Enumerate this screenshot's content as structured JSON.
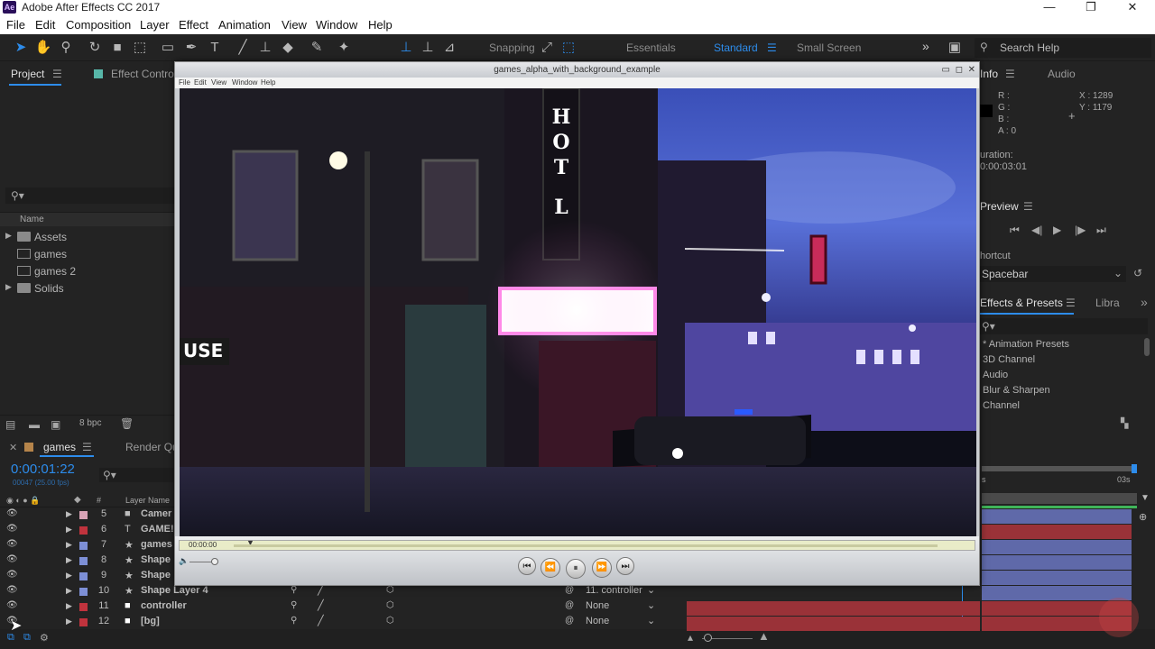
{
  "app": {
    "title": "Adobe After Effects CC 2017",
    "logo": "Ae",
    "minimize": "—",
    "restore": "❐",
    "close": "✕"
  },
  "menu": [
    "File",
    "Edit",
    "Composition",
    "Layer",
    "Effect",
    "Animation",
    "View",
    "Window",
    "Help"
  ],
  "toolbar": {
    "snapping": "Snapping",
    "workspaces": [
      "Essentials",
      "Standard",
      "Small Screen"
    ],
    "active_workspace": "Standard",
    "search_placeholder": "Search Help",
    "overflow": "»"
  },
  "project_panel": {
    "tab": "Project",
    "effect_tab": "Effect Contro",
    "column_name": "Name",
    "items": [
      {
        "label": "Assets",
        "type": "folder",
        "expander": "▶"
      },
      {
        "label": "games",
        "type": "comp",
        "expander": ""
      },
      {
        "label": "games 2",
        "type": "comp",
        "expander": ""
      },
      {
        "label": "Solids",
        "type": "folder",
        "expander": "▶"
      }
    ],
    "bpc": "8 bpc"
  },
  "info_panel": {
    "tab": "Info",
    "audio_tab": "Audio",
    "r": "R :",
    "g": "G :",
    "b": "B :",
    "a": "A : 0",
    "x": "X : 1289",
    "y": "Y : 1179",
    "duration_label": "uration:",
    "duration_value": "0:00:03:01"
  },
  "preview_panel": {
    "tab": "Preview",
    "shortcut_label": "hortcut",
    "shortcut_value": "Spacebar"
  },
  "effects_panel": {
    "tab": "Effects & Presets",
    "libraries_tab": "Libra",
    "items": [
      "* Animation Presets",
      "3D Channel",
      "Audio",
      "Blur & Sharpen",
      "Channel"
    ]
  },
  "timeline": {
    "tab": "games",
    "render_tab": "Render Qu",
    "timecode": "0:00:01:22",
    "frame_info": "00047 (25.00 fps)",
    "col_num": "#",
    "col_layer": "Layer Name",
    "ruler_end": "03s",
    "ruler_start": "s",
    "layers": [
      {
        "num": "5",
        "name": "Camer",
        "type_icon": "camera",
        "color": "#d8a3b6",
        "parent": ""
      },
      {
        "num": "6",
        "name": "GAME!",
        "type_icon": "text",
        "color": "#c0333d",
        "parent": ""
      },
      {
        "num": "7",
        "name": "games",
        "type_icon": "star",
        "color": "#7d8fd6",
        "parent": ""
      },
      {
        "num": "8",
        "name": "Shape",
        "type_icon": "star",
        "color": "#7d8fd6",
        "parent": ""
      },
      {
        "num": "9",
        "name": "Shape",
        "type_icon": "star",
        "color": "#7d8fd6",
        "parent": ""
      },
      {
        "num": "10",
        "name": "Shape Layer 4",
        "type_icon": "star",
        "color": "#7d8fd6",
        "parent": "11. controller"
      },
      {
        "num": "11",
        "name": "controller",
        "type_icon": "solid",
        "color": "#c0333d",
        "parent": "None"
      },
      {
        "num": "12",
        "name": "[bg]",
        "type_icon": "solid",
        "color": "#c0333d",
        "parent": "None"
      }
    ]
  },
  "viewer": {
    "title": "games_alpha_with_background_example",
    "menu": [
      "File",
      "Edit",
      "View",
      "Window",
      "Help"
    ],
    "timecode": "00:00:00",
    "sign_letters": [
      "H",
      "O",
      "T",
      "L"
    ],
    "sign_side": "USE"
  },
  "colors": {
    "accent": "#2d8ceb",
    "timecode": "#2d8ceb",
    "bg": "#232323"
  }
}
